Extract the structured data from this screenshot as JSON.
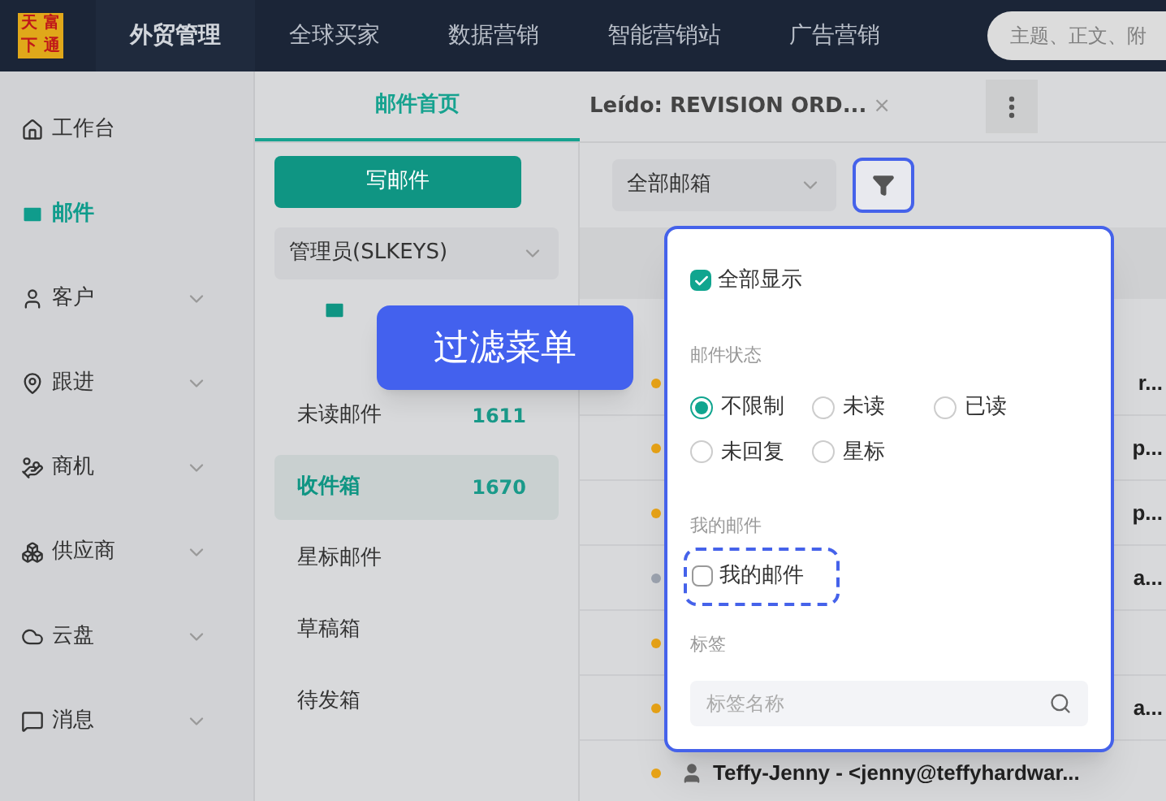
{
  "topbar": {
    "logo": [
      "天",
      "富",
      "下",
      "通"
    ],
    "nav": [
      {
        "label": "外贸管理",
        "selected": true
      },
      {
        "label": "全球买家",
        "selected": false
      },
      {
        "label": "数据营销",
        "selected": false
      },
      {
        "label": "智能营销站",
        "selected": false
      },
      {
        "label": "广告营销",
        "selected": false
      }
    ],
    "search": {
      "placeholder": "主题、正文、附"
    }
  },
  "sidebar": {
    "items": [
      {
        "label": "工作台",
        "selected": false,
        "expandable": false
      },
      {
        "label": "邮件",
        "selected": true,
        "expandable": false
      },
      {
        "label": "客户",
        "selected": false,
        "expandable": true
      },
      {
        "label": "跟进",
        "selected": false,
        "expandable": true
      },
      {
        "label": "商机",
        "selected": false,
        "expandable": true
      },
      {
        "label": "供应商",
        "selected": false,
        "expandable": true
      },
      {
        "label": "云盘",
        "selected": false,
        "expandable": true
      },
      {
        "label": "消息",
        "selected": false,
        "expandable": true
      }
    ]
  },
  "tabs": [
    {
      "label": "邮件首页",
      "selected": true
    },
    {
      "label": "Leído: REVISION ORD...",
      "selected": false,
      "close": "×"
    }
  ],
  "compose_button": "写邮件",
  "account_select": "管理员(SLKEYS)",
  "tooltip": "过滤菜单",
  "folders": [
    {
      "label": "未读邮件",
      "count": "1611",
      "selected": false
    },
    {
      "label": "收件箱",
      "count": "1670",
      "selected": true
    },
    {
      "label": "星标邮件",
      "selected": false
    },
    {
      "label": "草稿箱",
      "selected": false
    },
    {
      "label": "待发箱",
      "selected": false
    }
  ],
  "mailbox_select": "全部邮箱",
  "mail_rows": [
    {
      "text": "r...",
      "color": "#e8a317"
    },
    {
      "text": "p...",
      "color": "#e8a317"
    },
    {
      "text": "p...",
      "color": "#e8a317"
    },
    {
      "text": "a...",
      "color": "#9ca3af"
    },
    {
      "color": "#e8a317"
    },
    {
      "text": "a...",
      "color": "#e8a317"
    },
    {
      "text": "Teffy-Jenny - <jenny@teffyhardwar...",
      "color": "#e8a317"
    }
  ],
  "filter_menu": {
    "show_all": {
      "label": "全部显示",
      "checked": true
    },
    "status_title": "邮件状态",
    "status_options": [
      {
        "label": "不限制",
        "selected": true
      },
      {
        "label": "未读",
        "selected": false
      },
      {
        "label": "已读",
        "selected": false
      },
      {
        "label": "未回复",
        "selected": false
      },
      {
        "label": "星标",
        "selected": false
      }
    ],
    "mine_title": "我的邮件",
    "mine": {
      "label": "我的邮件",
      "checked": false
    },
    "tags_title": "标签",
    "tag_search": {
      "placeholder": "标签名称"
    }
  }
}
